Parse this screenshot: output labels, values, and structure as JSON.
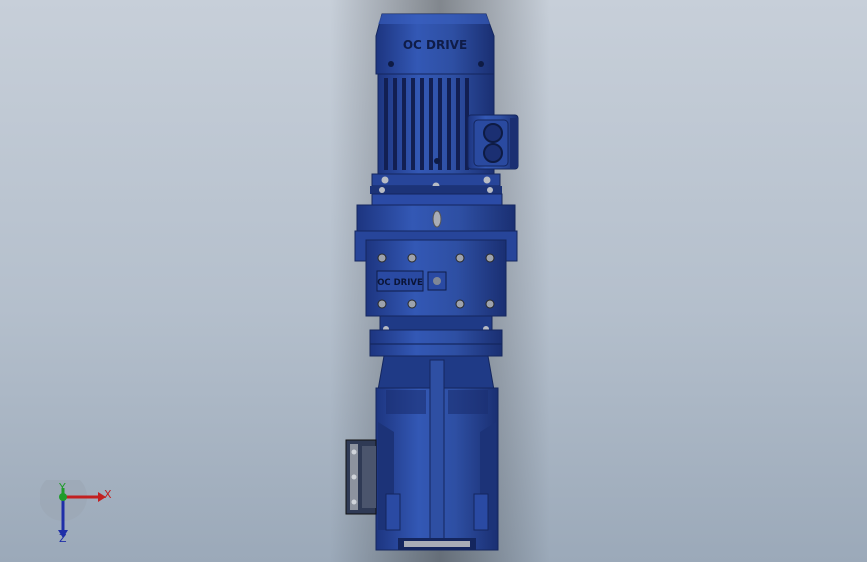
{
  "viewport": {
    "background_top": "#c7cfd9",
    "background_bottom": "#9ba9b9"
  },
  "model": {
    "body_color": "#2e4fa3",
    "motor_brand": "OC DRIVE",
    "gearbox_brand": "OC DRIVE"
  },
  "triad": {
    "x_label": "X",
    "y_label": "Y",
    "z_label": "Z",
    "x_color": "#c22020",
    "y_color": "#1f9c2a",
    "z_color": "#1f2fa8"
  }
}
